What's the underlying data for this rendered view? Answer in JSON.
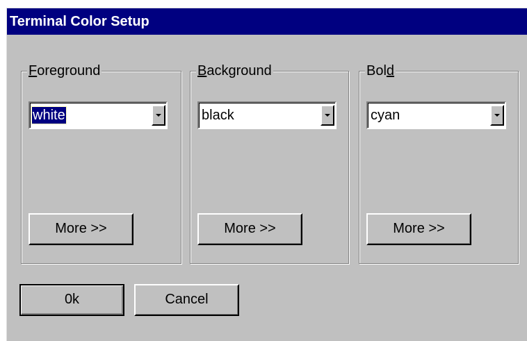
{
  "dialog": {
    "title": "Terminal Color Setup"
  },
  "groups": [
    {
      "label_mnemonic": "F",
      "label_rest": "oreground",
      "selected_value": "white",
      "more_label": "More >>"
    },
    {
      "label_mnemonic": "B",
      "label_rest": "ackground",
      "selected_value": "black",
      "more_label": "More >>"
    },
    {
      "label_prefix": "Bol",
      "label_mnemonic": "d",
      "selected_value": "cyan",
      "more_label": "More >>"
    }
  ],
  "buttons": {
    "ok_label": "0k",
    "cancel_label": "Cancel"
  },
  "colors": {
    "titlebar": "#000080",
    "dialog_face": "#c0c0c0",
    "selection": "#000080"
  }
}
